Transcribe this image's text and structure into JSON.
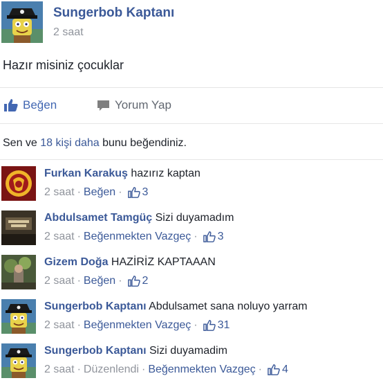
{
  "post": {
    "author": "Sungerbob Kaptanı",
    "time": "2 saat",
    "text": "Hazır misiniz çocuklar"
  },
  "actions": {
    "like_label": "Beğen",
    "comment_label": "Yorum Yap"
  },
  "likes_summary": {
    "prefix": "Sen ve ",
    "count_link": "18 kişi daha",
    "suffix": " bunu beğendiniz."
  },
  "comments": [
    {
      "author": "Furkan Karakuş",
      "text": " hazırız kaptan",
      "time": "2 saat",
      "edited": "",
      "action": "Beğen",
      "likes": "3"
    },
    {
      "author": "Abdulsamet Tamgüç",
      "text": " Sizi duyamadım",
      "time": "2 saat",
      "edited": "",
      "action": "Beğenmekten Vazgeç",
      "likes": "3"
    },
    {
      "author": "Gizem Doğa",
      "text": " HAZİRİZ KAPTAAAN",
      "time": "2 saat",
      "edited": "",
      "action": "Beğen",
      "likes": "2"
    },
    {
      "author": "Sungerbob Kaptanı",
      "text": " Abdulsamet sana noluyo yarram",
      "time": "2 saat",
      "edited": "",
      "action": "Beğenmekten Vazgeç",
      "likes": "31"
    },
    {
      "author": "Sungerbob Kaptanı",
      "text": " Sizi duyamadim",
      "time": "2 saat",
      "edited": "Düzenlendi",
      "action": "Beğenmekten Vazgeç",
      "likes": "4"
    }
  ],
  "colors": {
    "link": "#3b5998",
    "meta": "#90949c",
    "like_blue": "#4267b2"
  },
  "icons": {
    "like": "thumbs-up-icon",
    "comment": "speech-bubble-icon"
  }
}
